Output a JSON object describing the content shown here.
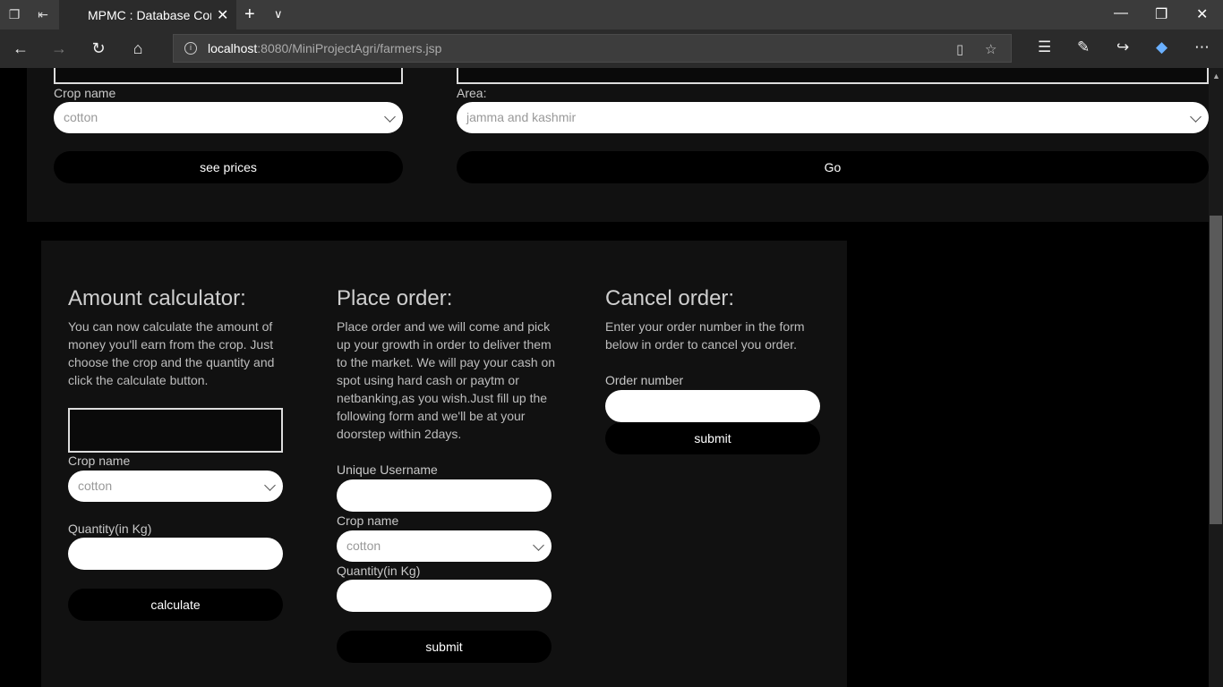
{
  "browser": {
    "tab_title": "MPMC : Database Conn",
    "url_host": "localhost",
    "url_rest": ":8080/MiniProjectAgri/farmers.jsp"
  },
  "price_section": {
    "crop_label": "Crop name",
    "crop_value": "cotton",
    "see_prices_label": "see prices",
    "area_label": "Area:",
    "area_value": "jamma and kashmir",
    "go_label": "Go"
  },
  "amount_calculator": {
    "heading": "Amount calculator:",
    "description": "You can now calculate the amount of money you'll earn from the crop. Just choose the crop and the quantity and click the calculate button.",
    "crop_label": "Crop name",
    "crop_value": "cotton",
    "quantity_label": "Quantity(in Kg)",
    "calculate_label": "calculate"
  },
  "place_order": {
    "heading": "Place order:",
    "description": "Place order and we will come and pick up your growth in order to deliver them to the market. We will pay your cash on spot using hard cash or paytm or netbanking,as you wish.Just fill up the following form and we'll be at your doorstep within 2days.",
    "username_label": "Unique Username",
    "crop_label": "Crop name",
    "crop_value": "cotton",
    "quantity_label": "Quantity(in Kg)",
    "submit_label": "submit"
  },
  "cancel_order": {
    "heading": "Cancel order:",
    "description": "Enter your order number in the form below in order to cancel you order.",
    "order_label": "Order number",
    "submit_label": "submit"
  }
}
